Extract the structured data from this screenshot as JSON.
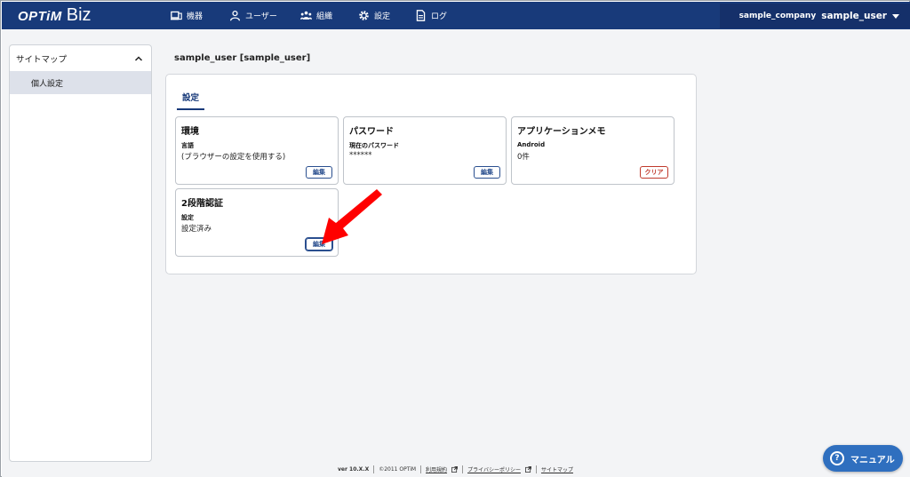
{
  "header": {
    "logo_main": "OPTiM",
    "logo_sub": "Biz",
    "nav": [
      {
        "label": "機器",
        "icon": "device-icon"
      },
      {
        "label": "ユーザー",
        "icon": "user-icon"
      },
      {
        "label": "組織",
        "icon": "organization-icon"
      },
      {
        "label": "設定",
        "icon": "gear-icon"
      },
      {
        "label": "ログ",
        "icon": "document-icon"
      }
    ],
    "company": "sample_company",
    "user": "sample_user"
  },
  "sidebar": {
    "heading": "サイトマップ",
    "items": [
      {
        "label": "個人設定"
      }
    ]
  },
  "main": {
    "page_title": "sample_user [sample_user]",
    "tab_label": "設定",
    "cards": [
      {
        "title": "環境",
        "label": "言語",
        "value": "(ブラウザーの設定を使用する)",
        "button": "編集"
      },
      {
        "title": "パスワード",
        "label": "現在のパスワード",
        "value": "******",
        "button": "編集"
      },
      {
        "title": "アプリケーションメモ",
        "label": "Android",
        "value": "0件",
        "button": "クリア"
      },
      {
        "title": "2段階認証",
        "label": "設定",
        "value": "設定済み",
        "button": "編集"
      }
    ]
  },
  "footer": {
    "version": "ver 10.X.X",
    "copyright": "©2011 OPTiM",
    "terms": "利用規約",
    "privacy": "プライバシーポリシー",
    "sitemap": "サイトマップ"
  },
  "manual_button": "マニュアル",
  "colors": {
    "header_bg": "#183a7a",
    "accent": "#2a4f8f",
    "danger": "#c0392b",
    "arrow": "#ff0000",
    "manual_bg": "#2f6fbf"
  }
}
